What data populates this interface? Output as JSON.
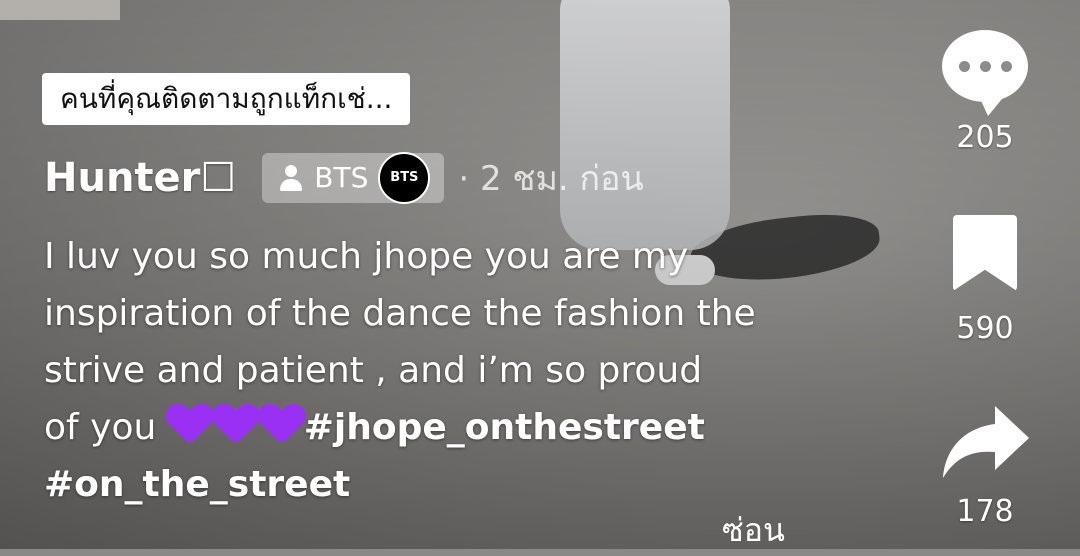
{
  "tag_banner": "คนที่คุณติดตามถูกแท็กเช่...",
  "post": {
    "username": "Hunter☐",
    "group_chip_label": "BTS",
    "group_logo_text": "BTS",
    "time": "· 2 ชม. ก่อน"
  },
  "caption": {
    "line1": "I luv you so much jhope you are my",
    "line2": "inspiration of the dance the fashion the",
    "line3": "strive and patient , and i’m so proud",
    "line4_prefix": "of you",
    "emoji": "💜💜💜",
    "hashtag1": "#jhope_onthestreet",
    "hashtag2": "#on_the_street"
  },
  "hide_label": "ซ่อน",
  "actions": {
    "comments": {
      "icon": "comment-bubble-icon",
      "count": "205"
    },
    "bookmarks": {
      "icon": "bookmark-icon",
      "count": "590"
    },
    "shares": {
      "icon": "share-arrow-icon",
      "count": "178"
    }
  },
  "colors": {
    "heart": "#9b30f5",
    "text": "#ffffff"
  }
}
